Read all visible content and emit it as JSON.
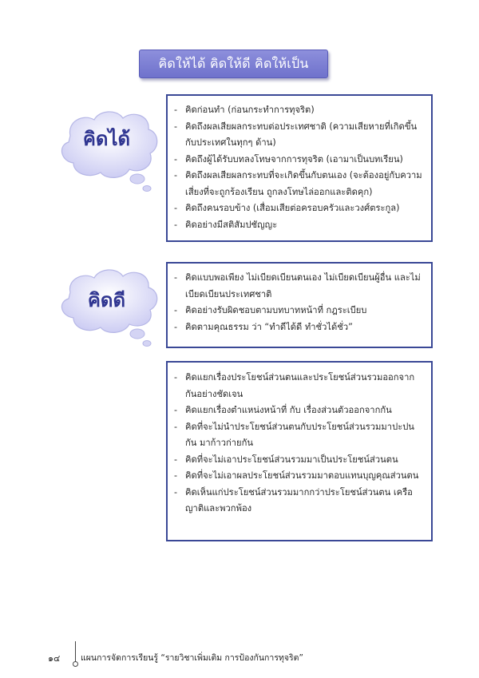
{
  "title": "คิดให้ได้ คิดให้ดี คิดให้เป็น",
  "sections": [
    {
      "cloud_label": "คิดได้",
      "items": [
        "คิดก่อนทำ (ก่อนกระทำการทุจริต)",
        "คิดถึงผลเสียผลกระทบต่อประเทศชาติ (ความเสียหายที่เกิดขึ้นกับประเทศในทุกๆ ด้าน)",
        "คิดถึงผู้ได้รับบทลงโทษจากการทุจริต (เอามาเป็นบทเรียน)",
        "คิดถึงผลเสียผลกระทบที่จะเกิดขึ้นกับตนเอง (จะต้องอยู่กับความเสี่ยงที่จะถูกร้องเรียน ถูกลงโทษไล่ออกและติดคุก)",
        "คิดถึงคนรอบข้าง (เสื่อมเสียต่อครอบครัวและวงศ์ตระกูล)",
        "คิดอย่างมีสติสัมปชัญญะ"
      ]
    },
    {
      "cloud_label": "คิดดี",
      "items": [
        "คิดแบบพอเพียง ไม่เบียดเบียนตนเอง ไม่เบียดเบียนผู้อื่น และไม่เบียดเบียนประเทศชาติ",
        "คิดอย่างรับผิดชอบตามบทบาทหน้าที่ กฎระเบียบ",
        "คิดตามคุณธรรม ว่า “ทำดีได้ดี ทำชั่วได้ชั่ว”"
      ]
    },
    {
      "cloud_label": "",
      "items": [
        "คิดแยกเรื่องประโยชน์ส่วนตนและประโยชน์ส่วนรวมออกจากกันอย่างชัดเจน",
        "คิดแยกเรื่องตำแหน่งหน้าที่ กับ เรื่องส่วนตัวออกจากกัน",
        "คิดที่จะไม่นำประโยชน์ส่วนตนกับประโยชน์ส่วนรวมมาปะปนกัน มาก้าวก่ายกัน",
        "คิดที่จะไม่เอาประโยชน์ส่วนรวมมาเป็นประโยชน์ส่วนตน",
        "คิดที่จะไม่เอาผลประโยชน์ส่วนรวมมาตอบแทนบุญคุณส่วนตน",
        "คิดเห็นแก่ประโยชน์ส่วนรวมมากกว่าประโยชน์ส่วนตน เครือญาติและพวกพ้อง"
      ]
    }
  ],
  "footer": {
    "page_number": "๑๔",
    "text": "แผนการจัดการเรียนรู้ “รายวิชาเพิ่มเติม การป้องกันการทุจริต”"
  }
}
